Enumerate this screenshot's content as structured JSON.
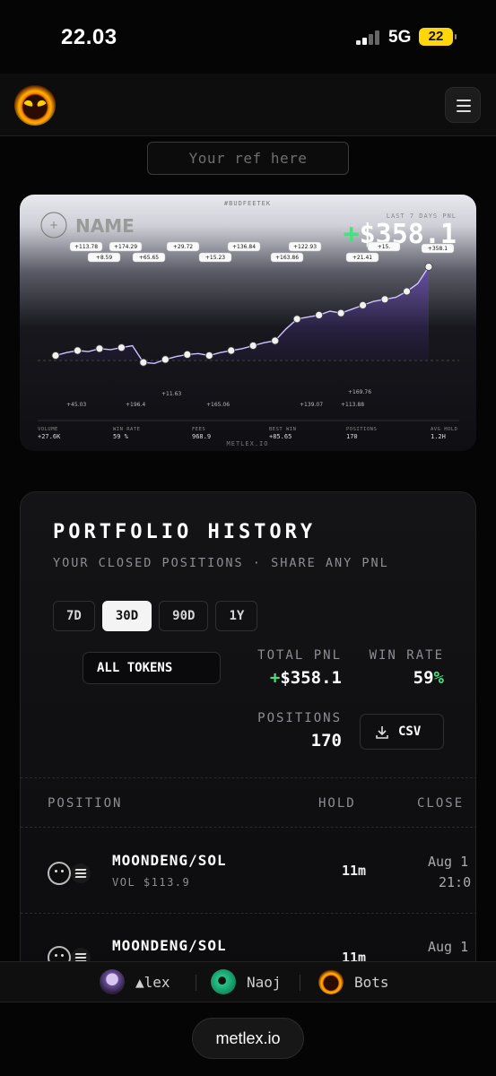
{
  "status": {
    "time": "22.03",
    "network": "5G",
    "battery": "22"
  },
  "ref": {
    "placeholder": "Your ref here"
  },
  "card": {
    "tag": "#BUDFEETEK",
    "name": "NAME",
    "period_label": "LAST 7 DAYS PNL",
    "pnl": "+$358.1",
    "site": "METLEX.IO",
    "chip_labels": [
      "+113.78",
      "+8.59",
      "+174.29",
      "+65.65",
      "+29.72",
      "+15.23",
      "+136.84",
      "+163.86",
      "+122.93",
      "+21.41",
      "+15.",
      "+358.1"
    ],
    "low_labels": [
      "+45.03",
      "+196.4",
      "+11.63",
      "+165.06",
      "+139.07",
      "+113.88",
      "+169.76"
    ],
    "stats": [
      {
        "label": "VOLUME",
        "value": "+27.6K"
      },
      {
        "label": "WIN RATE",
        "value": "59 %"
      },
      {
        "label": "FEES",
        "value": "968.9"
      },
      {
        "label": "BEST WIN",
        "value": "+85.65"
      },
      {
        "label": "POSITIONS",
        "value": "170"
      },
      {
        "label": "AVG HOLD",
        "value": "1.2H"
      }
    ],
    "chart_points": [
      0.05,
      0.08,
      0.1,
      0.09,
      0.12,
      0.11,
      0.13,
      0.15,
      -0.02,
      -0.03,
      0.01,
      0.04,
      0.06,
      0.07,
      0.05,
      0.08,
      0.1,
      0.12,
      0.15,
      0.18,
      0.2,
      0.32,
      0.42,
      0.44,
      0.46,
      0.5,
      0.48,
      0.52,
      0.56,
      0.6,
      0.62,
      0.64,
      0.7,
      0.78,
      0.95
    ]
  },
  "portfolio": {
    "title": "PORTFOLIO HISTORY",
    "subtitle": "YOUR CLOSED POSITIONS · SHARE ANY PNL",
    "tabs": [
      "7D",
      "30D",
      "90D",
      "1Y"
    ],
    "active_tab": "30D",
    "token_filter": "ALL TOKENS",
    "total_pnl_label": "TOTAL PNL",
    "total_pnl": "+$358.1",
    "win_rate_label": "WIN RATE",
    "win_rate": "59%",
    "positions_label": "POSITIONS",
    "positions": "170",
    "csv_label": "CSV",
    "columns": [
      "POSITION",
      "HOLD",
      "CLOSE"
    ],
    "rows": [
      {
        "pair": "MOONDENG/SOL",
        "volume": "VOL $113.9",
        "hold": "11m",
        "close_date": "Aug 1",
        "close_time": "21:0"
      },
      {
        "pair": "MOONDENG/SOL",
        "volume": "",
        "hold": "11m",
        "close_date": "Aug 1",
        "close_time": ""
      }
    ]
  },
  "accounts": [
    {
      "name": "▲lex",
      "color": "#8a6bb8"
    },
    {
      "name": "Naoj",
      "color": "#27c48a"
    },
    {
      "name": "Bots",
      "color": "#ff8a00"
    }
  ],
  "footer": {
    "url": "metlex.io"
  },
  "colors": {
    "positive": "#4ade80",
    "accent": "#ffd60a",
    "chart_fill": "#6a4ab8"
  }
}
